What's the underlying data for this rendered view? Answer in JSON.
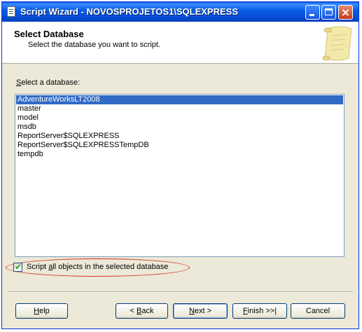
{
  "window": {
    "title": "Script Wizard - NOVOSPROJETOS1\\SQLEXPRESS",
    "close_glyph": "×"
  },
  "header": {
    "title": "Select Database",
    "subtitle": "Select the database you want to script."
  },
  "database_list": {
    "label_mnemonic": "S",
    "label_rest": "elect a database:",
    "items": [
      "AdventureWorksLT2008",
      "master",
      "model",
      "msdb",
      "ReportServer$SQLEXPRESS",
      "ReportServer$SQLEXPRESSTempDB",
      "tempdb"
    ],
    "selected_index": 0
  },
  "script_all_checkbox": {
    "checked": true,
    "check_glyph": "✔",
    "label_before": "Script ",
    "label_mnemonic": "a",
    "label_after": "ll objects in the selected database"
  },
  "buttons": {
    "help": {
      "mnemonic": "H",
      "rest": "elp"
    },
    "back": {
      "prefix": "< ",
      "mnemonic": "B",
      "rest": "ack"
    },
    "next": {
      "mnemonic": "N",
      "rest": "ext >"
    },
    "finish": {
      "mnemonic": "F",
      "rest": "inish >>|"
    },
    "cancel": {
      "label": "Cancel"
    }
  },
  "icons": {
    "app": "script-wizard-icon",
    "header_art": "scroll-icon"
  },
  "colors": {
    "titlebar": "#0a5ee6",
    "selection": "#316ac5",
    "highlight_ellipse": "#d0302a"
  }
}
